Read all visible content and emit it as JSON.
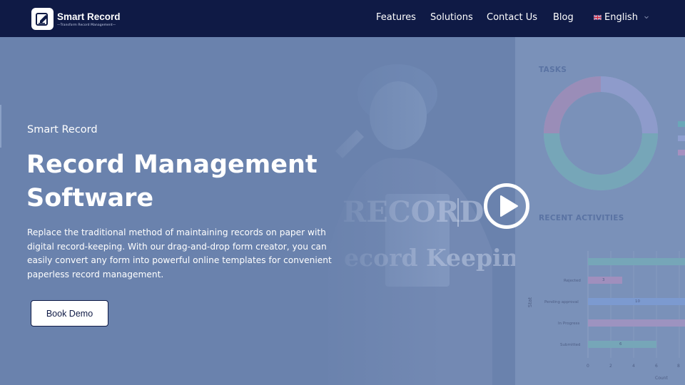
{
  "brand": {
    "name": "Smart Record",
    "tagline": "—Transform Record Management—"
  },
  "nav": {
    "links": [
      "Features",
      "Solutions",
      "Contact Us",
      "Blog"
    ],
    "language": "English"
  },
  "hero": {
    "eyebrow": "Smart Record",
    "headline": "Record Management Software",
    "description": "Replace the traditional method of maintaining records on paper with digital record-keeping. With our drag-and-drop form creator, you can easily convert any form into powerful online templates for convenient paperless record management.",
    "cta_label": "Book Demo"
  },
  "video_preview": {
    "watermark_large": "RECORD",
    "watermark_sub": "ecord Keeping Software",
    "dashboard": {
      "tasks_title": "TASKS",
      "activities_title": "RECENT ACTIVITIES",
      "bar_labels": [
        "Rejected",
        "Pending approval",
        "In Progress",
        "Submitted"
      ],
      "bar_values": [
        "3",
        "10",
        "",
        "6"
      ],
      "axis_ticks": [
        "0",
        "2",
        "4",
        "6",
        "8"
      ],
      "x_axis_label": "Count",
      "y_axis_label": "Stat"
    }
  },
  "colors": {
    "navbar": "#0f1a45",
    "hero_bg": "#6a82ad",
    "text": "#ffffff",
    "button_border": "#0f1a45"
  }
}
